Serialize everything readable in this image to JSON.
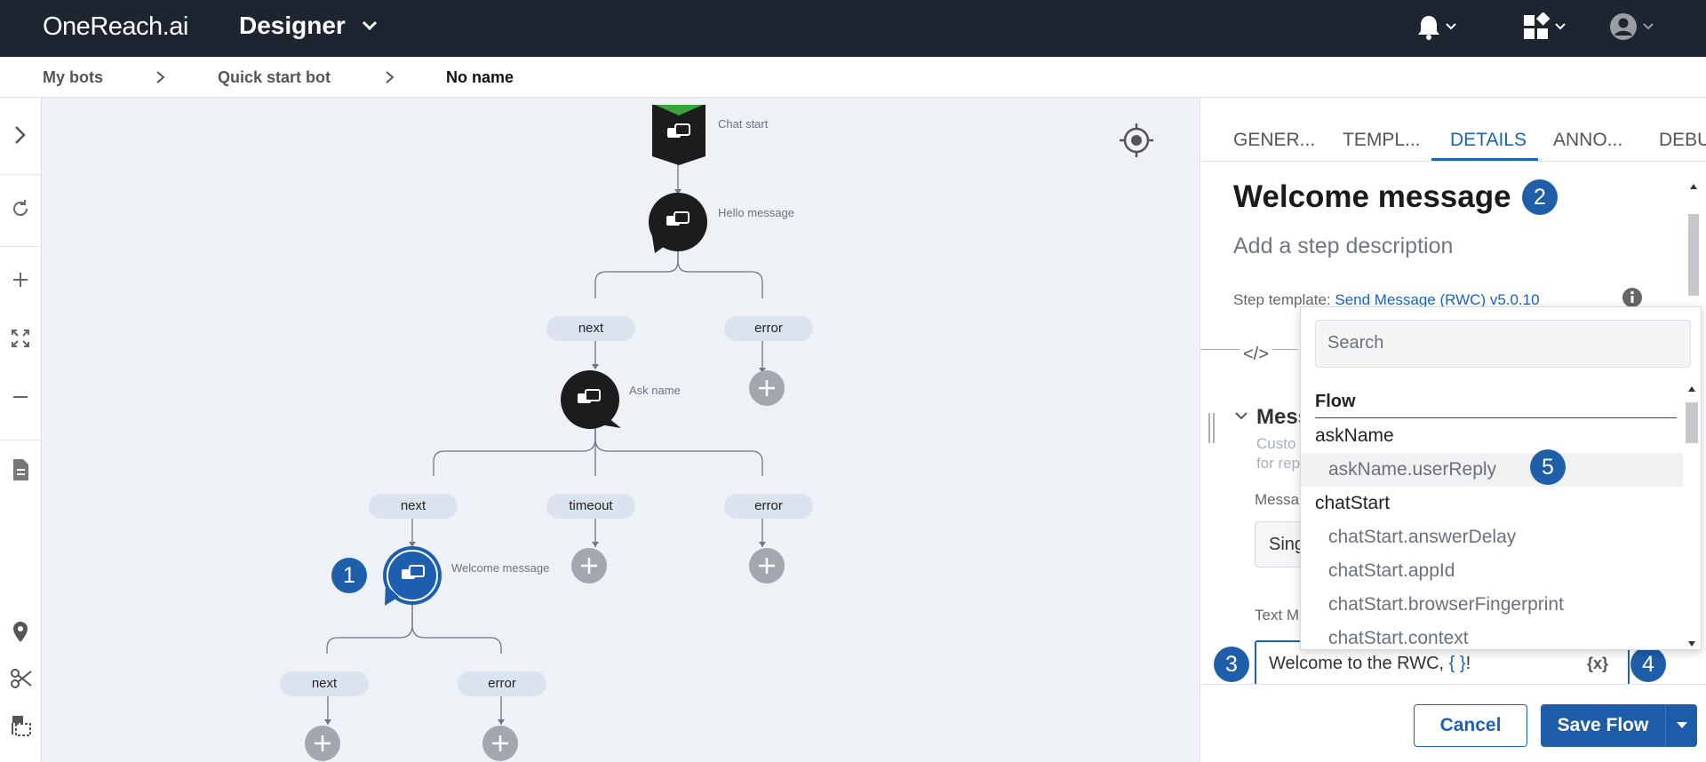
{
  "topbar": {
    "logo": "OneReach.ai",
    "app_title": "Designer",
    "icons": [
      "chevron-down-icon",
      "bell-icon",
      "apps-icon",
      "user-account-icon"
    ]
  },
  "breadcrumbs": [
    "My bots",
    "Quick start bot",
    "No name"
  ],
  "left_toolbar": {
    "icons": [
      "expand-panel-icon",
      "refresh-icon",
      "zoom-in-icon",
      "fit-screen-icon",
      "zoom-out-icon",
      "document-icon",
      "location-pin-icon",
      "scissors-icon",
      "select-area-icon"
    ]
  },
  "canvas": {
    "nodes": {
      "chat_start": "Chat start",
      "hello": "Hello message",
      "ask_name": "Ask name",
      "welcome": "Welcome message"
    },
    "pills": {
      "hello_next": "next",
      "hello_error": "error",
      "ask_next": "next",
      "ask_timeout": "timeout",
      "ask_error": "error",
      "welcome_next": "next",
      "welcome_error": "error"
    },
    "callouts": {
      "one": "1",
      "two": "2",
      "three": "3",
      "four": "4",
      "five": "5"
    }
  },
  "panel": {
    "tabs": [
      "GENER...",
      "TEMPL...",
      "DETAILS",
      "ANNO...",
      "DEBU"
    ],
    "active_tab": "DETAILS",
    "step_title": "Welcome message",
    "step_description_placeholder": "Add a step description",
    "step_template_label": "Step template:",
    "step_template_link": "Send Message (RWC) v5.0.10",
    "code_toggle": "</>",
    "section_title": "Mess",
    "section_subtext_1": "Custo",
    "section_subtext_2": "for rep",
    "message_label": "Messa",
    "message_select_value": "Sing",
    "text_label": "Text M",
    "text_value_prefix": "Welcome to the RWC, ",
    "text_value_var": "{ }",
    "text_value_suffix": "!",
    "insert_var_button": "{x}",
    "cancel_label": "Cancel",
    "save_label": "Save Flow"
  },
  "dropdown": {
    "search_placeholder": "Search",
    "section_header": "Flow",
    "items": [
      {
        "label": "askName",
        "kind": "group"
      },
      {
        "label": "askName.userReply",
        "kind": "child",
        "highlighted": true
      },
      {
        "label": "chatStart",
        "kind": "group"
      },
      {
        "label": "chatStart.answerDelay",
        "kind": "child"
      },
      {
        "label": "chatStart.appId",
        "kind": "child"
      },
      {
        "label": "chatStart.browserFingerprint",
        "kind": "child"
      },
      {
        "label": "chatStart.context",
        "kind": "child"
      }
    ]
  },
  "colors": {
    "topbar": "#1d2531",
    "accent": "#1d63b5",
    "callout": "#1f5ea8",
    "canvas_bg": "#eef1f5",
    "node_dark": "#1c1c1c",
    "add_button": "#a3a8ae"
  }
}
